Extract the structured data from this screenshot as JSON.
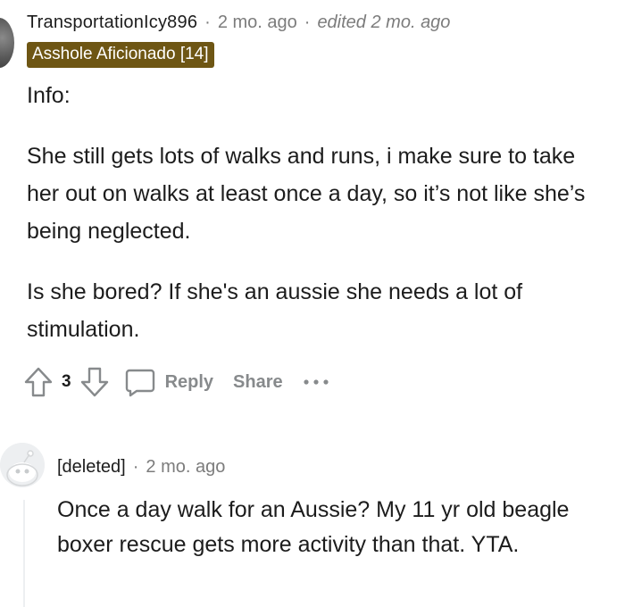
{
  "comment1": {
    "username": "TransportationIcy896",
    "separator": "·",
    "time": "2 mo. ago",
    "edited": "edited 2 mo. ago",
    "flair": "Asshole Aficionado [14]",
    "paragraphs": [
      "Info:",
      "She still gets lots of walks and runs, i make sure to take her out on walks at least once a day, so it’s not like she’s being neglected.",
      "Is she bored? If she's an aussie she needs a lot of stimulation."
    ],
    "votes": "3",
    "reply_label": "Reply",
    "share_label": "Share",
    "more_label": "···"
  },
  "comment2": {
    "username": "[deleted]",
    "separator": "·",
    "time": "2 mo. ago",
    "body": "Once a day walk for an Aussie? My 11 yr old beagle boxer rescue gets more activity than that. YTA."
  },
  "colors": {
    "flair_bg": "#6e5614",
    "meta_gray": "#7c7c7c",
    "action_gray": "#878a8c"
  },
  "icons": [
    "avatar",
    "upvote-icon",
    "downvote-icon",
    "comment-icon",
    "more-icon",
    "snoo-avatar-icon"
  ]
}
